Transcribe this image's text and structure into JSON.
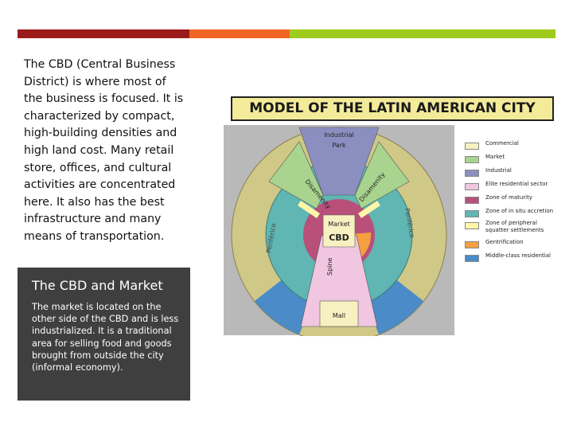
{
  "slide": {
    "body_text": "The CBD (Central Business District) is where most of the business is focused. It is characterized by compact, high-building densities and high land cost. Many retail store, offices, and cultural activities are concentrated here. It also has the best infrastructure and many means of transportation.",
    "box_title": "The CBD and Market",
    "box_text": "The market is located on the other side of the CBD and is less industrialized. It is a traditional area for selling food and goods brought from outside the city (informal economy)."
  },
  "diagram": {
    "title": "MODEL OF THE LATIN AMERICAN CITY",
    "labels": {
      "industrial_park_1": "Industrial",
      "industrial_park_2": "Park",
      "disamenity_left": "Disamenity",
      "disamenity_right": "Disamenity",
      "market": "Market",
      "cbd": "CBD",
      "spine": "Spine",
      "mall": "Mall",
      "periferico_left": "Periférico",
      "periferico_right": "Periférico"
    },
    "legend": [
      {
        "label": "Commercial",
        "color": "#f7f0c0"
      },
      {
        "label": "Market",
        "color": "#a9d48f"
      },
      {
        "label": "Industrial",
        "color": "#8b8fc0"
      },
      {
        "label": "Elite residential sector",
        "color": "#f0c6e0"
      },
      {
        "label": "Zone of maturity",
        "color": "#b8507a"
      },
      {
        "label": "Zone of in situ accretion",
        "color": "#5fb6b2"
      },
      {
        "label": "Zone of peripheral squatter settlements",
        "color": "#fff6a8"
      },
      {
        "label": "Gentrification",
        "color": "#f4a040"
      },
      {
        "label": "Middle-class residential",
        "color": "#4a8bc8"
      }
    ]
  }
}
